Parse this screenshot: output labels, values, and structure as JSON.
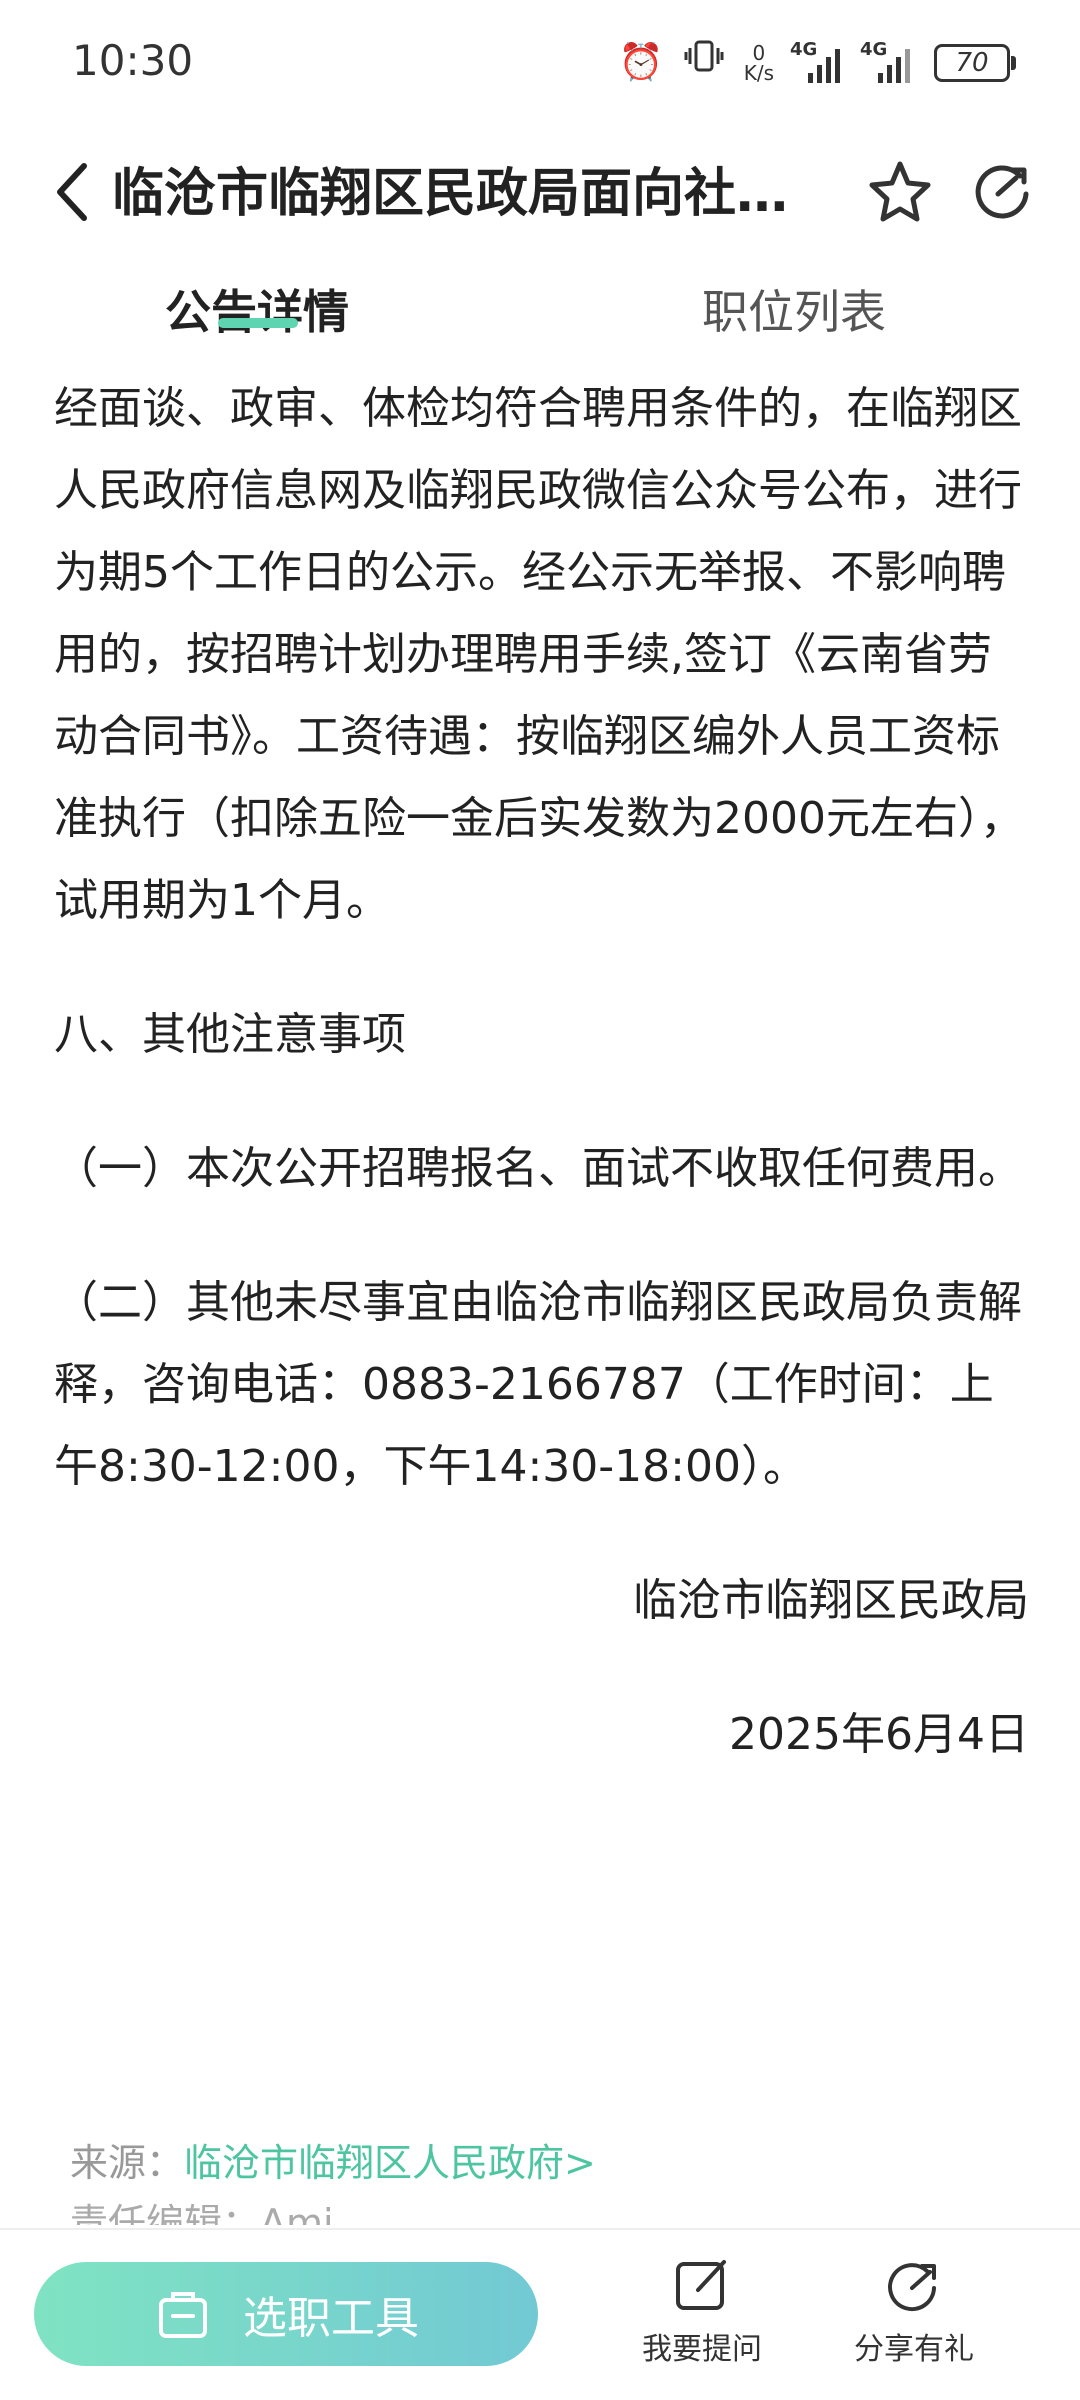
{
  "status": {
    "time": "10:30",
    "net_speed_value": "0",
    "net_speed_unit": "K/s",
    "signal1_label": "4G",
    "signal2_label": "4G",
    "battery": "70"
  },
  "header": {
    "title": "临沧市临翔区民政局面向社…",
    "icons": [
      "back-arrow-icon",
      "star-icon",
      "share-icon"
    ]
  },
  "tabs": [
    {
      "label": "公告详情",
      "active": true
    },
    {
      "label": "职位列表",
      "active": false
    }
  ],
  "article": {
    "para1": "经面谈、政审、体检均符合聘用条件的，在临翔区人民政府信息网及临翔民政微信公众号公布，进行为期5个工作日的公示。经公示无举报、不影响聘用的，按招聘计划办理聘用手续,签订《云南省劳动合同书》。工资待遇：按临翔区编外人员工资标准执行（扣除五险一金后实发数为2000元左右），试用期为1个月。",
    "section8_heading": "八、其他注意事项",
    "item1": "（一）本次公开招聘报名、面试不收取任何费用。",
    "item2": "（二）其他未尽事宜由临沧市临翔区民政局负责解释，咨询电话：0883-2166787（工作时间：上午8:30-12:00，下午14:30-18:00）。",
    "signature": "临沧市临翔区民政局",
    "date": "2025年6月4日"
  },
  "source": {
    "label": "来源：",
    "link_text": "临沧市临翔区人民政府>",
    "editor_label": "责任编辑：Ami"
  },
  "bottom_bar": {
    "tool_button_label": "选职工具",
    "ask_label": "我要提问",
    "share_label": "分享有礼",
    "accent_color": "#5fd4b0"
  }
}
